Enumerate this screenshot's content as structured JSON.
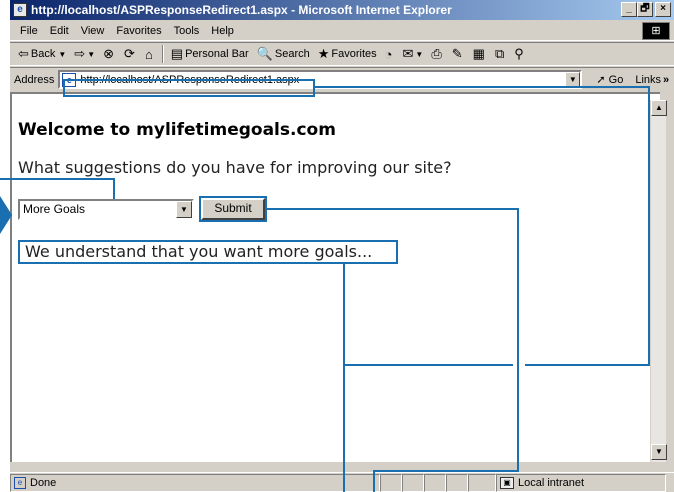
{
  "window": {
    "title": "http://localhost/ASPResponseRedirect1.aspx - Microsoft Internet Explorer",
    "buttons": [
      "_",
      "🗗",
      "×"
    ]
  },
  "menu": [
    "File",
    "Edit",
    "View",
    "Favorites",
    "Tools",
    "Help"
  ],
  "toolbar": {
    "back": "Back",
    "personal_bar": "Personal Bar",
    "search": "Search",
    "favorites": "Favorites"
  },
  "address": {
    "label": "Address",
    "url": "http://localhost/ASPResponseRedirect1.aspx",
    "go": "Go",
    "links": "Links"
  },
  "page": {
    "heading": "Welcome to mylifetimegoals.com",
    "question": "What suggestions do you have for improving our site?",
    "select_value": "More Goals",
    "submit_label": "Submit",
    "message": "We understand that you want more goals..."
  },
  "status": {
    "text": "Done",
    "zone": "Local intranet"
  },
  "colors": {
    "callout": "#1a6fb0",
    "titlebar_start": "#0a246a",
    "titlebar_end": "#a6caf0"
  }
}
